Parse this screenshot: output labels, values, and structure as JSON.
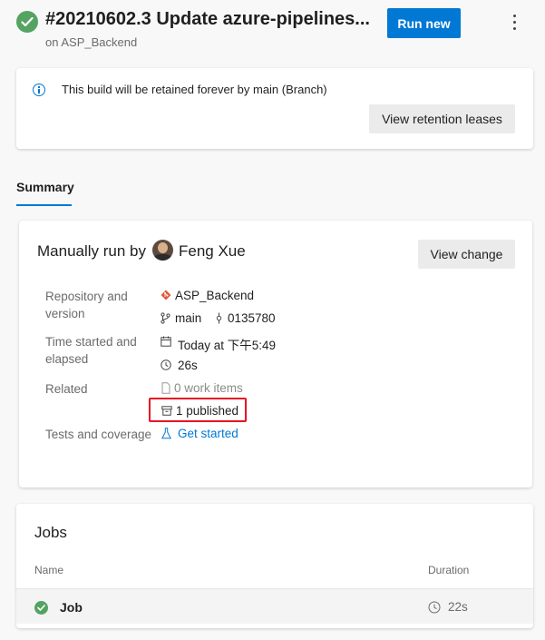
{
  "header": {
    "build_title": "#20210602.3 Update azure-pipelines...",
    "pipeline": "on ASP_Backend",
    "run_new_label": "Run new",
    "status_icon": "check-circle-icon",
    "more_icon": "more-vertical-icon"
  },
  "retention": {
    "message": "This build will be retained forever by main (Branch)",
    "button_label": "View retention leases",
    "icon": "info-icon"
  },
  "tabs": [
    {
      "label": "Summary",
      "active": true
    }
  ],
  "summary": {
    "manual_run_prefix": "Manually run by",
    "user_name": "Feng Xue",
    "view_change_label": "View change",
    "labels": {
      "repo_line1": "Repository and",
      "repo_line2": "version",
      "time_line1": "Time started and",
      "time_line2": "elapsed",
      "related": "Related",
      "tests": "Tests and coverage"
    },
    "repository": "ASP_Backend",
    "branch": "main",
    "commit": "0135780",
    "started": "Today at 下午5:49",
    "elapsed": "26s",
    "work_items": "0 work items",
    "published": "1 published",
    "tests_link": "Get started"
  },
  "jobs": {
    "title": "Jobs",
    "columns": [
      "Name",
      "Duration"
    ],
    "rows": [
      {
        "name": "Job",
        "duration": "22s",
        "status": "succeeded"
      }
    ]
  },
  "colors": {
    "accent": "#0078d4",
    "success": "#55a362",
    "highlight": "#e81123",
    "repo_icon": "#e05a3a"
  }
}
